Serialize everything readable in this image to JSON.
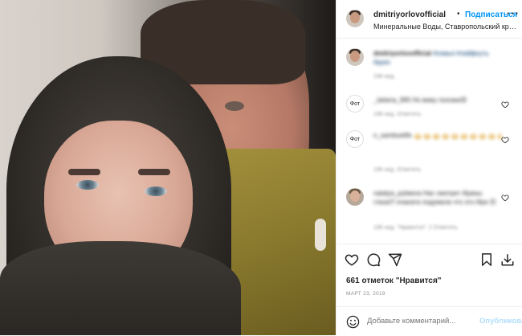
{
  "header": {
    "username": "dmitriyorlovofficial",
    "dot": "•",
    "follow_label": "Подписаться",
    "more": "···",
    "location": "Минеральные Воды, Ставропольский край"
  },
  "caption": {
    "username": "dmitriyorlovofficial",
    "text": "#семья #лайфхуть #руко",
    "meta": "196 нед."
  },
  "comments": [
    {
      "avatar_label": "Фот",
      "text": "_tatiana_995 Но вижу похожа😍",
      "meta": "196 нед.   Ответить"
    },
    {
      "avatar_label": "Фот",
      "text": "n_samboelife",
      "emoji": "😂😂😂😂😂😂😂😂😂😂😂😂😂😂",
      "meta": "196 нед.   Ответить"
    },
    {
      "avatar_label": "",
      "text": "natalya_pyliaeva Нас смотрит Ирины глаза!!! очаната подумала что это Ира 😊",
      "meta": "196 нед.   \"Нравится\": 2   Ответить"
    }
  ],
  "actions": {
    "likes": "661 отметок \"Нравится\"",
    "date": "МАРТ 23, 2019"
  },
  "add_comment": {
    "placeholder": "Добавьте комментарий...",
    "publish_label": "Опубликовать"
  },
  "colors": {
    "accent": "#0095f6",
    "publish_disabled": "#b2dffc",
    "text": "#262626",
    "muted": "#8e8e8e"
  },
  "icons": [
    "heart-icon",
    "comment-icon",
    "share-icon",
    "bookmark-icon",
    "download-icon",
    "smile-icon"
  ]
}
